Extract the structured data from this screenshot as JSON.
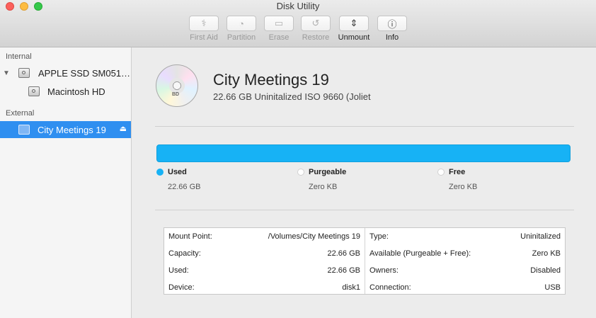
{
  "window": {
    "title": "Disk Utility"
  },
  "toolbar": [
    {
      "label": "First Aid",
      "icon": "stethoscope-icon",
      "glyph": "⚕",
      "enabled": false
    },
    {
      "label": "Partition",
      "icon": "partition-pie-icon",
      "glyph": "◔",
      "enabled": false
    },
    {
      "label": "Erase",
      "icon": "erase-drive-icon",
      "glyph": "▭",
      "enabled": false
    },
    {
      "label": "Restore",
      "icon": "restore-arrow-icon",
      "glyph": "↺",
      "enabled": false
    },
    {
      "label": "Unmount",
      "icon": "unmount-icon",
      "glyph": "⇕",
      "enabled": true
    },
    {
      "label": "Info",
      "icon": "info-icon",
      "glyph": "ⓘ",
      "enabled": true
    }
  ],
  "sidebar": {
    "internal_label": "Internal",
    "external_label": "External",
    "items": [
      {
        "label": "APPLE SSD SM051…",
        "icon": "internal-disk-icon"
      },
      {
        "label": "Macintosh HD",
        "icon": "volume-disk-icon"
      },
      {
        "label": "City Meetings 19",
        "icon": "external-disk-icon",
        "selected": true,
        "eject": "⏏"
      }
    ]
  },
  "volume": {
    "name": "City Meetings 19",
    "subtitle": "22.66 GB Uninitalized ISO 9660 (Joliet",
    "disc_label": "BD",
    "used_fraction": 1.0,
    "accent_color": "#17b2f5"
  },
  "legend": [
    {
      "label": "Used",
      "value": "22.66 GB"
    },
    {
      "label": "Purgeable",
      "value": "Zero KB"
    },
    {
      "label": "Free",
      "value": "Zero KB"
    }
  ],
  "info": {
    "left": [
      {
        "key": "Mount Point:",
        "value": "/Volumes/City Meetings 19"
      },
      {
        "key": "Capacity:",
        "value": "22.66 GB"
      },
      {
        "key": "Used:",
        "value": "22.66 GB"
      },
      {
        "key": "Device:",
        "value": "disk1"
      }
    ],
    "right": [
      {
        "key": "Type:",
        "value": "Uninitalized"
      },
      {
        "key": "Available (Purgeable + Free):",
        "value": "Zero KB"
      },
      {
        "key": "Owners:",
        "value": "Disabled"
      },
      {
        "key": "Connection:",
        "value": "USB"
      }
    ]
  }
}
